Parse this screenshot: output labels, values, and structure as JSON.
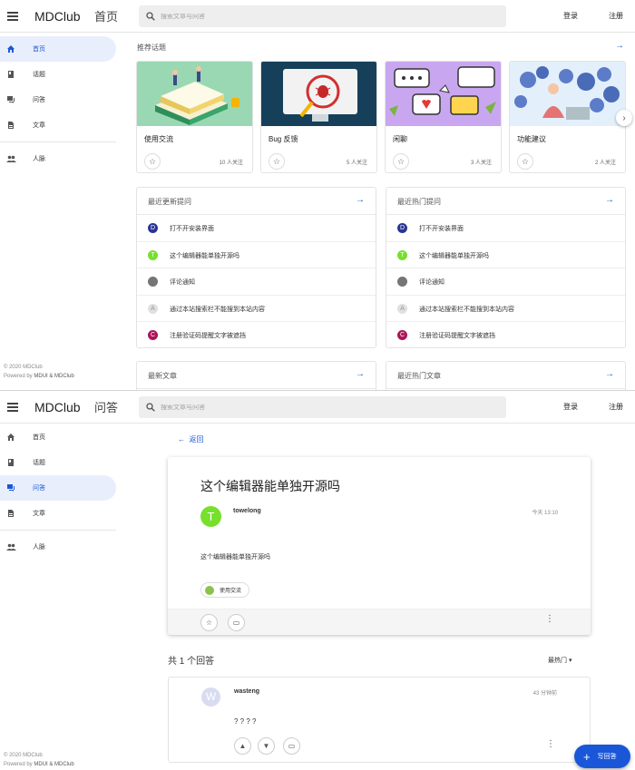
{
  "colors": {
    "accent": "#1a57d8",
    "nav_active_bg": "#e8eefc"
  },
  "app": {
    "brand": "MDClub",
    "login": "登录",
    "register": "注册",
    "search_placeholder": "搜索文章与问答"
  },
  "home": {
    "page_title": "首页",
    "nav": [
      {
        "label": "首页",
        "icon": "home-icon",
        "active": true
      },
      {
        "label": "话题",
        "icon": "book-icon",
        "active": false
      },
      {
        "label": "问答",
        "icon": "forum-icon",
        "active": false
      },
      {
        "label": "文章",
        "icon": "article-icon",
        "active": false
      },
      {
        "label": "人脉",
        "icon": "people-icon",
        "active": false
      }
    ],
    "footer_copyright": "© 2020 MDClub",
    "footer_powered_prefix": "Powered by ",
    "footer_powered_link": "MDUI & MDClub",
    "recommended_title": "推荐话题",
    "topics": [
      {
        "name": "使用交流",
        "followers": "10 人关注"
      },
      {
        "name": "Bug 反馈",
        "followers": "5 人关注"
      },
      {
        "name": "闲聊",
        "followers": "3 人关注"
      },
      {
        "name": "功能建议",
        "followers": "2 人关注"
      }
    ],
    "recent_questions": {
      "title": "最近更新提问",
      "items": [
        {
          "avatar": "D",
          "avatar_color": "#283593",
          "text": "打不开安装界面"
        },
        {
          "avatar": "T",
          "avatar_color": "#76e02b",
          "text": "这个编辑器能单独开源吗"
        },
        {
          "avatar": "",
          "avatar_color": "#757575",
          "text": "评论通知"
        },
        {
          "avatar": "A",
          "avatar_color": "#e0e0e0",
          "text": "通过本站搜索栏不能搜到本站内容"
        },
        {
          "avatar": "C",
          "avatar_color": "#ad1457",
          "text": "注册验证码提醒文字被遮挡"
        }
      ]
    },
    "hot_questions": {
      "title": "最近热门提问",
      "items": [
        {
          "avatar": "D",
          "avatar_color": "#283593",
          "text": "打不开安装界面"
        },
        {
          "avatar": "T",
          "avatar_color": "#76e02b",
          "text": "这个编辑器能单独开源吗"
        },
        {
          "avatar": "",
          "avatar_color": "#757575",
          "text": "评论通知"
        },
        {
          "avatar": "A",
          "avatar_color": "#e0e0e0",
          "text": "通过本站搜索栏不能搜到本站内容"
        },
        {
          "avatar": "C",
          "avatar_color": "#ad1457",
          "text": "注册验证码提醒文字被遮挡"
        }
      ]
    },
    "latest_articles_title": "最新文章",
    "hot_articles_title": "最近热门文章"
  },
  "question": {
    "page_title": "问答",
    "nav": [
      {
        "label": "首页",
        "icon": "home-icon",
        "active": false
      },
      {
        "label": "话题",
        "icon": "book-icon",
        "active": false
      },
      {
        "label": "问答",
        "icon": "forum-icon",
        "active": true
      },
      {
        "label": "文章",
        "icon": "article-icon",
        "active": false
      },
      {
        "label": "人脉",
        "icon": "people-icon",
        "active": false
      }
    ],
    "footer_copyright": "© 2020 MDClub",
    "footer_powered_prefix": "Powered by ",
    "footer_powered_link": "MDUI & MDClub",
    "back_label": "返回",
    "title": "这个编辑器能单独开源吗",
    "author_initial": "T",
    "author": "towelong",
    "time": "今天 13:10",
    "body": "这个编辑器能单独开源吗",
    "topic_chip": "使用交流",
    "answer_count": "共 1 个回答",
    "sort_label": "最热门",
    "answer": {
      "author_initial": "W",
      "author": "wasteng",
      "time": "43 分钟前",
      "body": "? ? ? ?"
    },
    "fab_label": "写回答"
  }
}
